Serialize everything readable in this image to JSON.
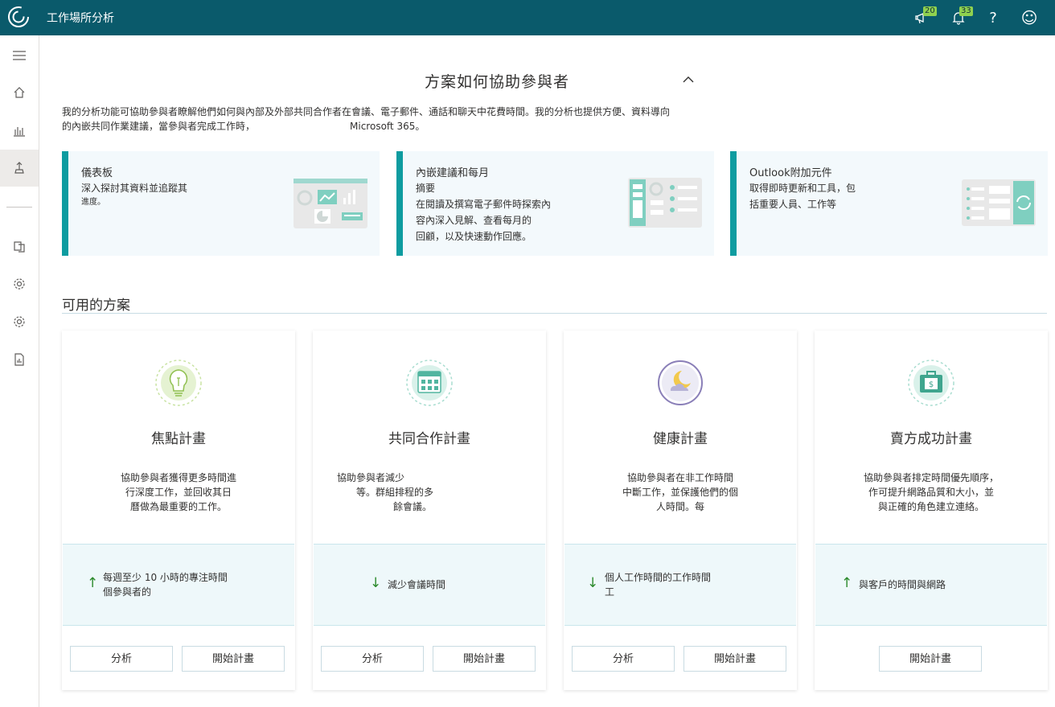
{
  "app": {
    "title": "工作場所分析"
  },
  "header": {
    "icons": [
      {
        "name": "megaphone-icon",
        "badge": "20"
      },
      {
        "name": "bell-icon",
        "badge": "33"
      },
      {
        "name": "help-icon",
        "glyph": "?"
      },
      {
        "name": "smiley-icon",
        "glyph": "☺"
      }
    ]
  },
  "sidebar": {
    "items": [
      "hamburger-icon",
      "home-icon",
      "analysis-icon",
      "plans-icon",
      "data-sources-icon",
      "settings-icon",
      "org-settings-icon",
      "reports-icon"
    ]
  },
  "hero": {
    "title": "方案如何協助參與者",
    "intro_line1": "我的分析功能可協助參與者瞭解他們如何與內部及外部共同合作者在會議、電子郵件、通話和聊天中花費時間。我的分析也提供方便、資料導向",
    "intro_line2": "的內嵌共同作業建議，當參與者完成工作時，",
    "intro_line2b": "Microsoft 365。"
  },
  "features": [
    {
      "title": "儀表板",
      "desc": [
        "深入探討其資料並追蹤其",
        "進度。"
      ]
    },
    {
      "title": "內嵌建議和每月",
      "desc": [
        "摘要",
        "在閱讀及撰寫電子郵件時探索內",
        "容內深入見解、查看每月的",
        "回顧，以及快速動作回應。"
      ]
    },
    {
      "title": "Outlook附加元件",
      "desc": [
        "取得即時更新和工具，包",
        "括重要人員、工作等"
      ]
    }
  ],
  "plans_section": {
    "title": "可用的方案"
  },
  "plans": [
    {
      "title": "焦點計畫",
      "desc": [
        "協助參與者獲得更多時間進",
        "行深度工作，並回收其日",
        "曆做為最重要的工作。"
      ],
      "metric_arrow": "↑",
      "metric": [
        "每週至少 10 小時的專注時間",
        "個參與者的"
      ],
      "buttons": [
        "分析",
        "開始計畫"
      ]
    },
    {
      "title": "共同合作計畫",
      "desc": [
        "協助參與者減少",
        "等。群組排程的多",
        "餘會議。"
      ],
      "metric_arrow": "↓",
      "metric": [
        "減少會議時間"
      ],
      "buttons": [
        "分析",
        "開始計畫"
      ]
    },
    {
      "title": "健康計畫",
      "desc": [
        "協助參與者在非工作時間",
        "中斷工作，並保護他們的個",
        "人時間。每"
      ],
      "metric_arrow": "↓",
      "metric": [
        "個人工作時間的工作時間",
        "工"
      ],
      "buttons": [
        "分析",
        "開始計畫"
      ]
    },
    {
      "title": "賣方成功計畫",
      "desc": [
        "協助參與者排定時間優先順序，",
        "作可提升網路品質和大小，並",
        "與正確的角色建立連絡。"
      ],
      "metric_arrow": "↑",
      "metric": [
        "與客戶的時間與網路"
      ],
      "buttons": [
        "開始計畫"
      ]
    }
  ]
}
